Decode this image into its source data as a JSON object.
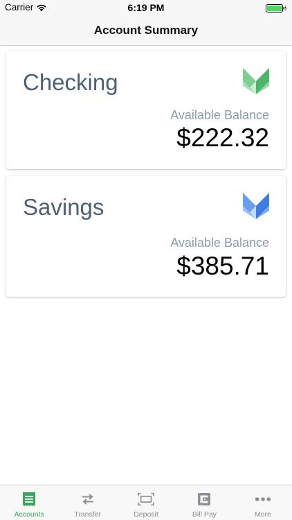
{
  "status_bar": {
    "carrier": "Carrier",
    "time": "6:19 PM"
  },
  "nav": {
    "title": "Account Summary"
  },
  "accounts": [
    {
      "name": "Checking",
      "balance_label": "Available Balance",
      "balance": "$222.32",
      "logo_color": "#5cc177"
    },
    {
      "name": "Savings",
      "balance_label": "Available Balance",
      "balance": "$385.71",
      "logo_color": "#4a86e8"
    }
  ],
  "tabs": [
    {
      "label": "Accounts",
      "icon": "accounts-icon",
      "active": true
    },
    {
      "label": "Transfer",
      "icon": "transfer-icon",
      "active": false
    },
    {
      "label": "Deposit",
      "icon": "deposit-icon",
      "active": false
    },
    {
      "label": "Bill Pay",
      "icon": "bill-pay-icon",
      "active": false
    },
    {
      "label": "More",
      "icon": "more-icon",
      "active": false
    }
  ],
  "colors": {
    "accent_green": "#3aa55a",
    "tab_inactive": "#8e8e93",
    "account_name": "#4d6175",
    "balance_label": "#8a9cad"
  }
}
